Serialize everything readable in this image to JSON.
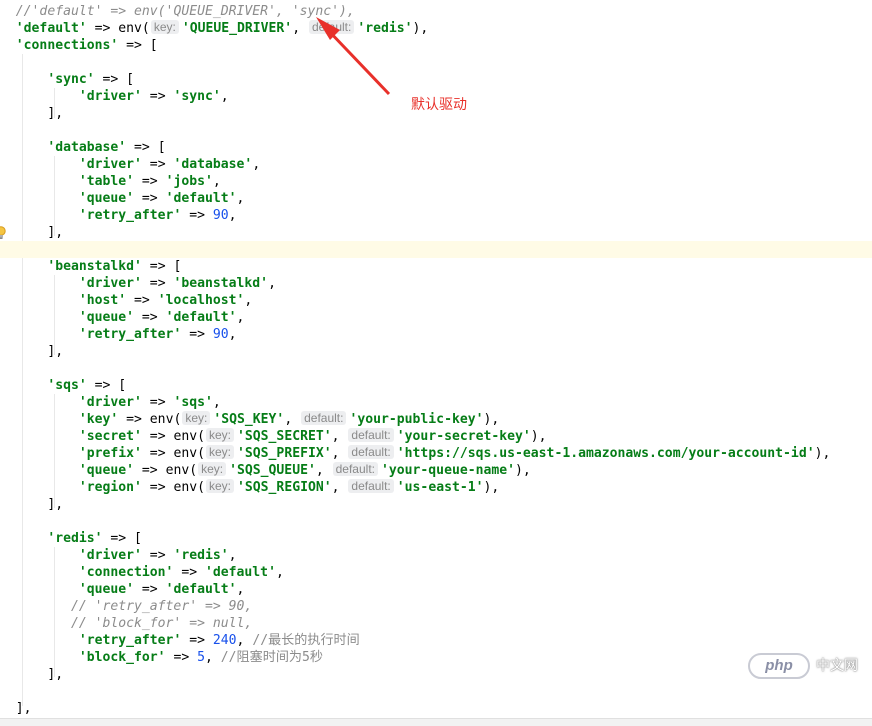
{
  "editor": {
    "annotation": {
      "label": "默认驱动",
      "color": "#e8302a"
    },
    "tokens": {
      "line0": "//'default' => env('QUEUE_DRIVER', 'sync'),",
      "line1a": "'default'",
      "line1b": " => env(",
      "line1c": "'QUEUE_DRIVER'",
      "line1d": ", ",
      "line1e": "'redis'",
      "line1f": "),",
      "line2a": "'connections'",
      "line2b": " => [",
      "sync_key": "'sync'",
      "sync_driver_value": "'sync'",
      "database_key": "'database'",
      "database_driver_value": "'database'",
      "database_table_value": "'jobs'",
      "database_queue_value": "'default'",
      "database_retry_value": "90",
      "beanstalkd_key": "'beanstalkd'",
      "beanstalkd_driver_value": "'beanstalkd'",
      "beanstalkd_host_value": "'localhost'",
      "beanstalkd_queue_value": "'default'",
      "beanstalkd_retry_value": "90",
      "sqs_key": "'sqs'",
      "sqs_driver_value": "'sqs'",
      "sqs_key_env": "'SQS_KEY'",
      "sqs_key_default": "'your-public-key'",
      "sqs_secret_env": "'SQS_SECRET'",
      "sqs_secret_default": "'your-secret-key'",
      "sqs_prefix_env": "'SQS_PREFIX'",
      "sqs_prefix_default": "'https://sqs.us-east-1.amazonaws.com/your-account-id'",
      "sqs_queue_env": "'SQS_QUEUE'",
      "sqs_queue_default": "'your-queue-name'",
      "sqs_region_env": "'SQS_REGION'",
      "sqs_region_default": "'us-east-1'",
      "redis_key": "'redis'",
      "redis_driver_value": "'redis'",
      "redis_connection_value": "'default'",
      "redis_queue_value": "'default'",
      "redis_comment_retry": "// 'retry_after' => 90,",
      "redis_comment_block": "// 'block_for' => null,",
      "redis_retry_value": "240",
      "redis_retry_comment": "//最长的执行时间",
      "redis_block_value": "5",
      "redis_block_comment": "//阻塞时间为5秒"
    },
    "keys": {
      "driver": "'driver'",
      "table": "'table'",
      "queue": "'queue'",
      "retry_after": "'retry_after'",
      "host": "'host'",
      "key": "'key'",
      "secret": "'secret'",
      "prefix": "'prefix'",
      "region": "'region'",
      "connection": "'connection'",
      "block_for": "'block_for'"
    },
    "syntax": {
      "arrow": " => ",
      "env_open": " => env(",
      "comma_space": ", ",
      "close_paren": "),",
      "comma": ",",
      "open_bracket": " => [",
      "close_bracket": "],"
    },
    "hints": {
      "key": "key:",
      "default": "default:"
    }
  },
  "watermark": {
    "logo": "php",
    "text": "中文网"
  }
}
